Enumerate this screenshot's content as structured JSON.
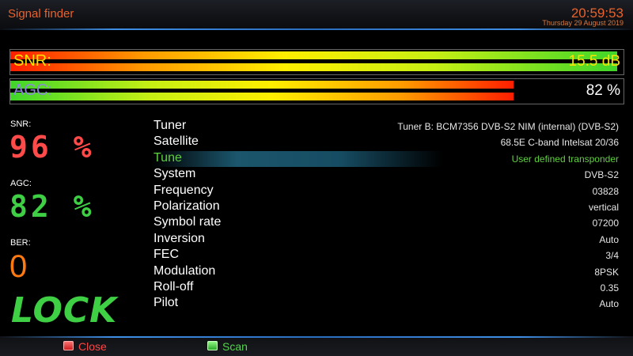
{
  "header": {
    "title": "Signal finder",
    "time": "20:59:53",
    "date": "Thursday 29 August 2019"
  },
  "bars": {
    "snr": {
      "label": "SNR:",
      "value": "15.5 dB",
      "level": 0.99
    },
    "agc": {
      "label": "AGC:",
      "value": "82 %",
      "level": 0.82
    }
  },
  "stats": {
    "snr_label": "SNR:",
    "snr_value": "96 %",
    "agc_label": "AGC:",
    "agc_value": "82 %",
    "ber_label": "BER:",
    "ber_value": "0",
    "lock": "LOCK"
  },
  "info": {
    "rows": [
      {
        "key": "Tuner",
        "value": "Tuner B: BCM7356 DVB-S2 NIM (internal) (DVB-S2)"
      },
      {
        "key": "Satellite",
        "value": "68.5E C-band Intelsat 20/36"
      },
      {
        "key": "Tune",
        "value": "User defined transponder"
      },
      {
        "key": "System",
        "value": "DVB-S2"
      },
      {
        "key": "Frequency",
        "value": "03828"
      },
      {
        "key": "Polarization",
        "value": "vertical"
      },
      {
        "key": "Symbol rate",
        "value": "07200"
      },
      {
        "key": "Inversion",
        "value": "Auto"
      },
      {
        "key": "FEC",
        "value": "3/4"
      },
      {
        "key": "Modulation",
        "value": "8PSK"
      },
      {
        "key": "Roll-off",
        "value": "0.35"
      },
      {
        "key": "Pilot",
        "value": "Auto"
      }
    ]
  },
  "footer": {
    "red_label": "Close",
    "green_label": "Scan"
  },
  "colors": {
    "accent": "#e8622a",
    "selected": "#60cf40",
    "snr_big": "#ff4a4a",
    "agc_big": "#3fcf45",
    "ber_big": "#ff7a10"
  }
}
